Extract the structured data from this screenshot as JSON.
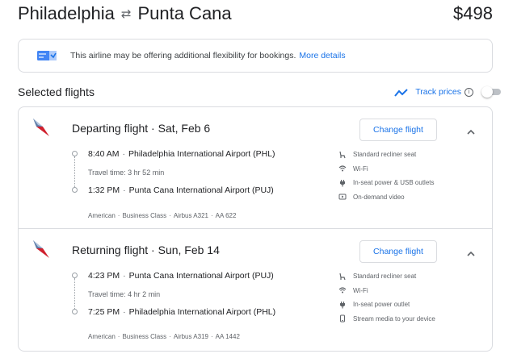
{
  "header": {
    "origin": "Philadelphia",
    "destination": "Punta Cana",
    "price": "$498"
  },
  "notice": {
    "text": "This airline may be offering additional flexibility for bookings.",
    "link": "More details"
  },
  "selected": {
    "title": "Selected flights",
    "track_label": "Track prices",
    "track_enabled": false
  },
  "departing": {
    "title": "Departing flight · Sat, Feb 6",
    "button": "Change flight",
    "dep_time": "8:40 AM",
    "dep_airport": "Philadelphia International Airport (PHL)",
    "duration": "Travel time: 3 hr 52 min",
    "arr_time": "1:32 PM",
    "arr_airport": "Punta Cana International Airport (PUJ)",
    "airline": "American",
    "cabin": "Business Class",
    "aircraft": "Airbus A321",
    "flight_no": "AA 622",
    "amenities": [
      "Standard recliner seat",
      "Wi-Fi",
      "In-seat power & USB outlets",
      "On-demand video"
    ]
  },
  "returning": {
    "title": "Returning flight · Sun, Feb 14",
    "button": "Change flight",
    "dep_time": "4:23 PM",
    "dep_airport": "Punta Cana International Airport (PUJ)",
    "duration": "Travel time: 4 hr 2 min",
    "arr_time": "7:25 PM",
    "arr_airport": "Philadelphia International Airport (PHL)",
    "airline": "American",
    "cabin": "Business Class",
    "aircraft": "Airbus A319",
    "flight_no": "AA 1442",
    "amenities": [
      "Standard recliner seat",
      "Wi-Fi",
      "In-seat power outlet",
      "Stream media to your device"
    ]
  },
  "colors": {
    "link": "#1a73e8",
    "text": "#202124",
    "muted": "#5f6368",
    "border": "#dadce0"
  }
}
